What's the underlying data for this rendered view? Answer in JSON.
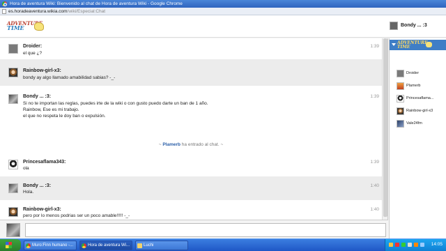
{
  "window": {
    "title": "Hora de aventura Wiki: Bienvenido al chat de Hora de aventura Wiki - Google Chrome"
  },
  "urlbar": {
    "host": "es.horadeaventura.wikia.com",
    "path": "/wiki/Especial:Chat"
  },
  "header": {
    "logo_line1": "ADVENTURE",
    "logo_line2": "TIME",
    "current_user": "Bondy ... :3"
  },
  "messages": [
    {
      "author": "Droider:",
      "time": "1:39",
      "lines": [
        "el que ¿?"
      ]
    },
    {
      "author": "Rainbow-girl-x3:",
      "time": "",
      "lines": [
        "bondy ay algo llamado amabilidad sabias? -_-"
      ]
    },
    {
      "author": "Bondy ... :3:",
      "time": "1:39",
      "lines": [
        "Si no te importan las reglas, puedes irte de la wiki o con gusto puedo darte un ban de 1 año.",
        "Rainbow, Ese es mi trabajo.",
        "el que no respeta le doy ban o expulsión."
      ]
    },
    {
      "author": "Princesaflama343:",
      "time": "1:39",
      "lines": [
        "ola"
      ]
    },
    {
      "author": "Bondy ... :3:",
      "time": "1:40",
      "lines": [
        "Hola."
      ]
    },
    {
      "author": "Rainbow-girl-x3:",
      "time": "1:40",
      "lines": [
        "pero por lo menos podrias ser un poco amable!!!!! -_-"
      ]
    }
  ],
  "system_message": {
    "prefix": "~ ",
    "user": "Plamerb",
    "text": " ha entrado al chat. ~"
  },
  "sidebar": {
    "users": [
      "Droider",
      "Plamerb",
      "Princesaflama...",
      "Rainbow-girl-x3",
      "Vale24fm"
    ]
  },
  "taskbar": {
    "tasks": [
      "Muro:Finn humano -...",
      "Hora de aventura Wi...",
      "Luchi"
    ],
    "clock": "14:05"
  }
}
